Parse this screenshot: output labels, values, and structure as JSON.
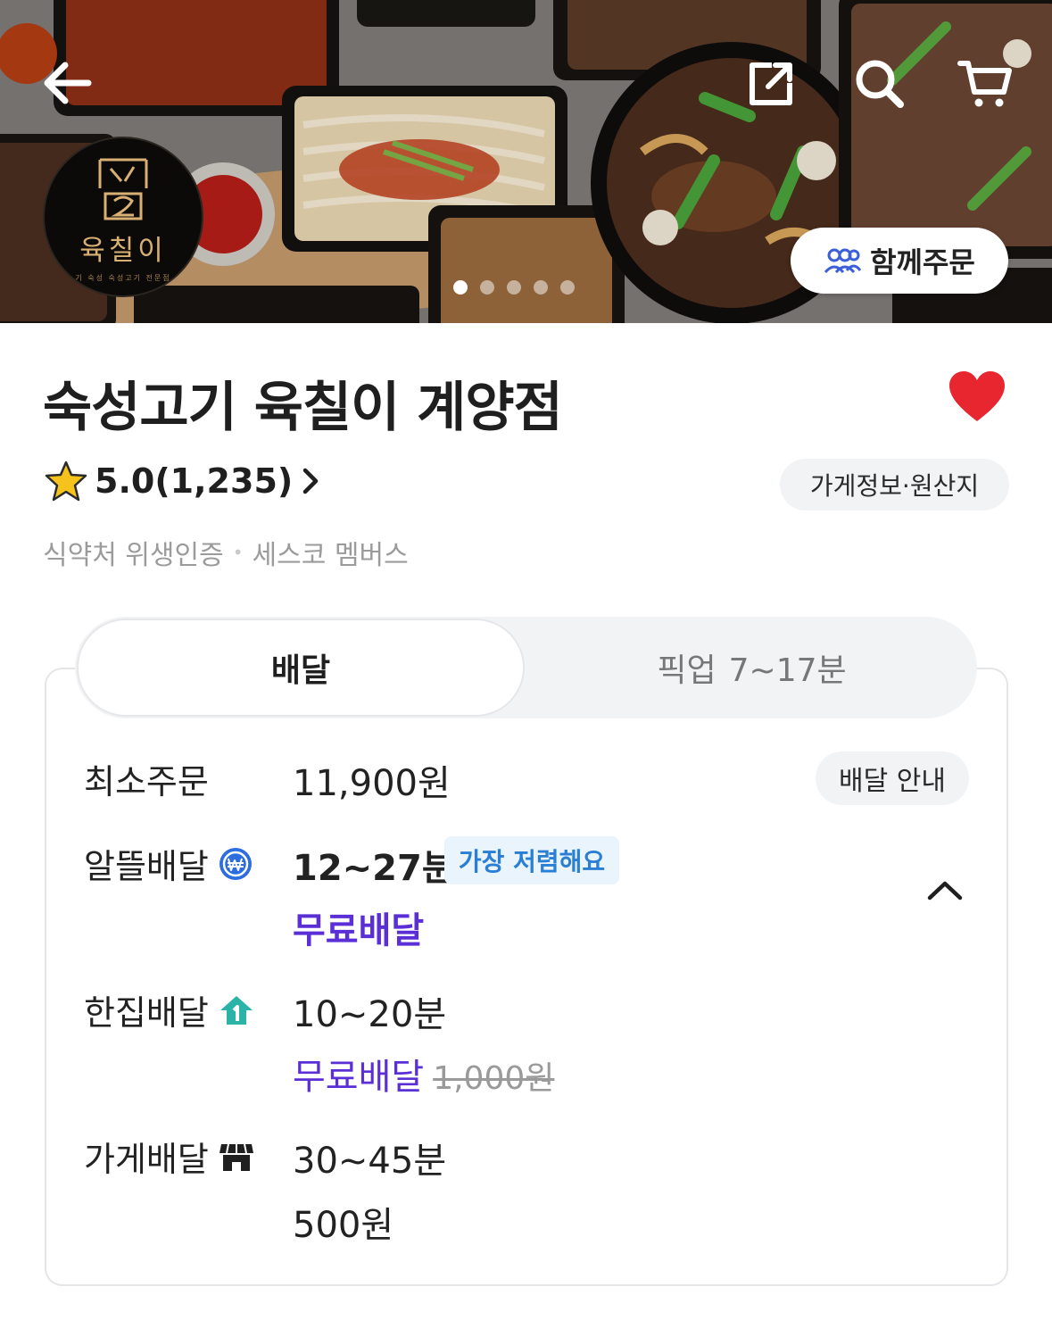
{
  "hero": {
    "back_icon": "arrow-left-icon",
    "share_icon": "share-icon",
    "search_icon": "search-icon",
    "cart_icon": "cart-icon",
    "logo_text": "육칠이",
    "logo_sub": "기 숙성 숙성고기 전문점",
    "group_order_label": "함께주문",
    "carousel_total": 5,
    "carousel_active": 1
  },
  "store": {
    "name": "숙성고기 육칠이 계양점",
    "favorite": true,
    "rating": "5.0(1,235)",
    "info_button": "가게정보·원산지",
    "certifications": [
      "식약처 위생인증",
      "세스코 멤버스"
    ]
  },
  "tabs": {
    "delivery": "배달",
    "pickup": "픽업",
    "pickup_time": "7~17분"
  },
  "delivery": {
    "min_order_label": "최소주문",
    "min_order_value": "11,900원",
    "guide_button": "배달 안내",
    "options": [
      {
        "label": "알뜰배달",
        "time": "12~27분",
        "badge": "가장 저렴해요",
        "fee": "무료배달",
        "icon": "won-coin-icon"
      },
      {
        "label": "한집배달",
        "time": "10~20분",
        "fee": "무료배달",
        "original_fee": "1,000원",
        "icon": "house-one-icon"
      },
      {
        "label": "가게배달",
        "time": "30~45분",
        "fee": "500원",
        "icon": "store-icon"
      }
    ]
  },
  "colors": {
    "accent_purple": "#5a2fd6",
    "badge_blue": "#2a7fd4",
    "heart_red": "#e8262f",
    "mint": "#2ab3a6"
  }
}
